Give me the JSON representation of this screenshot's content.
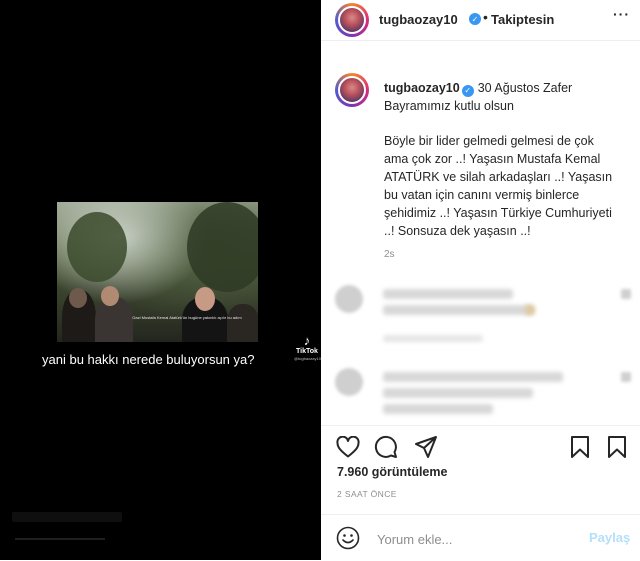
{
  "video": {
    "caption": "yani bu hakkı nerede buluyorsun ya?",
    "subtitle_small": "Gazi Mustafa Kemal Atatürk’ün bugüne yakınlık açılır bu adım",
    "tiktok_logo": "TikTok",
    "tiktok_handle": "@tugbaozay10"
  },
  "header": {
    "username": "tugbaozay10",
    "follow_status": "Takiptesin",
    "separator": "•",
    "more": "···"
  },
  "post": {
    "username": "tugbaozay10",
    "title": "30 Ağustos Zafer Bayramımız kutlu olsun",
    "body": "Böyle bir lider gelmedi gelmesi de çok ama çok zor ..! Yaşasın Mustafa Kemal ATATÜRK ve silah arkadaşları ..! Yaşasın bu vatan için canını vermiş binlerce şehidimiz ..! Yaşasın Türkiye Cumhuriyeti ..! Sonsuza dek yaşasın ..!",
    "time_ago": "2s"
  },
  "stats": {
    "views": "7.960 görüntüleme",
    "date": "2 SAAT ÖNCE"
  },
  "comment_box": {
    "placeholder": "Yorum ekle...",
    "post_label": "Paylaş"
  },
  "colors": {
    "verified": "#3897f0",
    "post_disabled": "#b2dffc",
    "muted": "#8e8e8e",
    "text": "#262626"
  },
  "icons": [
    "heart-icon",
    "comment-icon",
    "share-icon",
    "bookmark-icon",
    "emoji-icon",
    "tiktok-icon",
    "verified-icon",
    "more-icon"
  ]
}
